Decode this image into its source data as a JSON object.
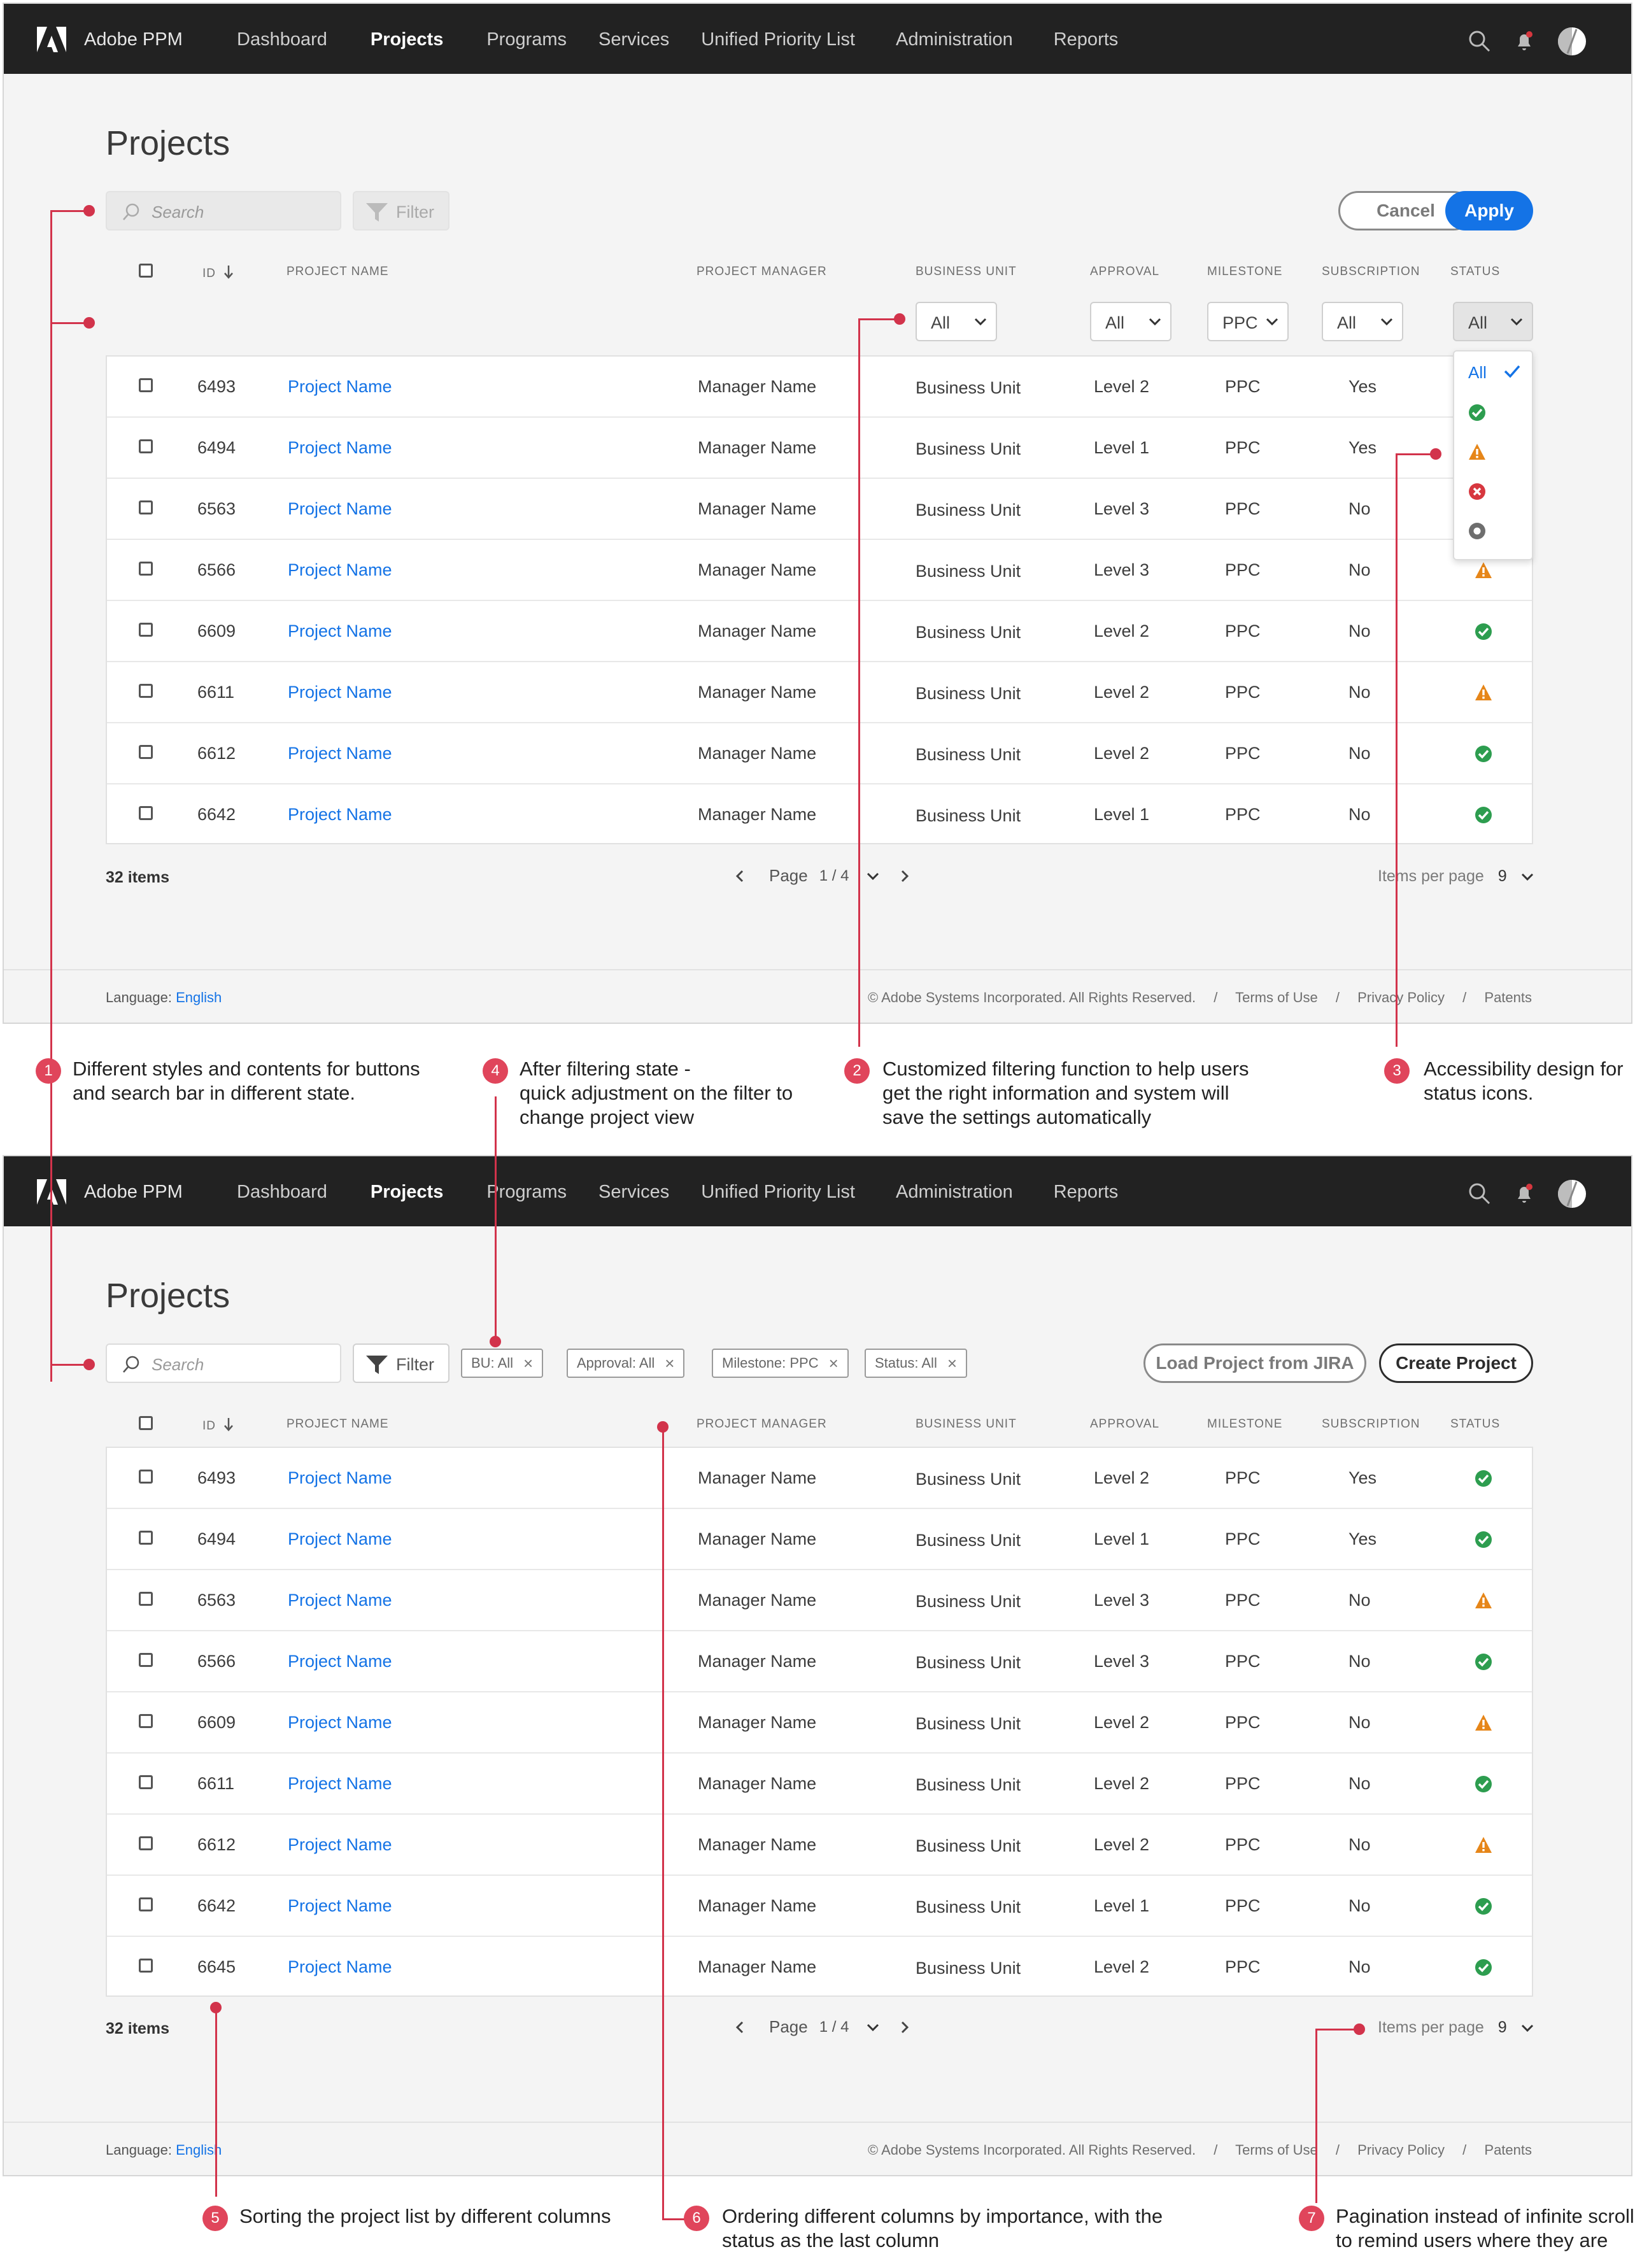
{
  "app": {
    "brand": "Adobe PPM"
  },
  "nav": {
    "items": [
      "Dashboard",
      "Projects",
      "Programs",
      "Services",
      "Unified Priority List",
      "Administration",
      "Reports"
    ],
    "active": "Projects"
  },
  "page": {
    "title": "Projects"
  },
  "search": {
    "placeholder": "Search"
  },
  "filter_label": "Filter",
  "buttons": {
    "cancel": "Cancel",
    "apply": "Apply",
    "load_jira": "Load Project from JIRA",
    "create_project": "Create Project"
  },
  "columns": {
    "id": "ID",
    "name": "PROJECT NAME",
    "manager": "PROJECT MANAGER",
    "bu": "BUSINESS UNIT",
    "approval": "APPROVAL",
    "milestone": "MILESTONE",
    "subscription": "SUBSCRIPTION",
    "status": "STATUS"
  },
  "column_filters": {
    "bu": "All",
    "approval": "All",
    "milestone": "PPC",
    "subscription": "All",
    "status": "All"
  },
  "status_menu": {
    "all_label": "All",
    "options": [
      "success",
      "warning",
      "error",
      "inactive"
    ]
  },
  "rows1": [
    {
      "id": "6493",
      "name": "Project Name",
      "manager": "Manager Name",
      "bu": "Business Unit",
      "approval": "Level 2",
      "milestone": "PPC",
      "subscription": "Yes",
      "status": null
    },
    {
      "id": "6494",
      "name": "Project Name",
      "manager": "Manager Name",
      "bu": "Business Unit",
      "approval": "Level 1",
      "milestone": "PPC",
      "subscription": "Yes",
      "status": null
    },
    {
      "id": "6563",
      "name": "Project Name",
      "manager": "Manager Name",
      "bu": "Business Unit",
      "approval": "Level 3",
      "milestone": "PPC",
      "subscription": "No",
      "status": null
    },
    {
      "id": "6566",
      "name": "Project Name",
      "manager": "Manager Name",
      "bu": "Business Unit",
      "approval": "Level 3",
      "milestone": "PPC",
      "subscription": "No",
      "status": "warning"
    },
    {
      "id": "6609",
      "name": "Project Name",
      "manager": "Manager Name",
      "bu": "Business Unit",
      "approval": "Level 2",
      "milestone": "PPC",
      "subscription": "No",
      "status": "success"
    },
    {
      "id": "6611",
      "name": "Project Name",
      "manager": "Manager Name",
      "bu": "Business Unit",
      "approval": "Level 2",
      "milestone": "PPC",
      "subscription": "No",
      "status": "warning"
    },
    {
      "id": "6612",
      "name": "Project Name",
      "manager": "Manager Name",
      "bu": "Business Unit",
      "approval": "Level 2",
      "milestone": "PPC",
      "subscription": "No",
      "status": "success"
    },
    {
      "id": "6642",
      "name": "Project Name",
      "manager": "Manager Name",
      "bu": "Business Unit",
      "approval": "Level 1",
      "milestone": "PPC",
      "subscription": "No",
      "status": "success"
    }
  ],
  "rows2": [
    {
      "id": "6493",
      "name": "Project Name",
      "manager": "Manager Name",
      "bu": "Business Unit",
      "approval": "Level 2",
      "milestone": "PPC",
      "subscription": "Yes",
      "status": "success"
    },
    {
      "id": "6494",
      "name": "Project Name",
      "manager": "Manager Name",
      "bu": "Business Unit",
      "approval": "Level 1",
      "milestone": "PPC",
      "subscription": "Yes",
      "status": "success"
    },
    {
      "id": "6563",
      "name": "Project Name",
      "manager": "Manager Name",
      "bu": "Business Unit",
      "approval": "Level 3",
      "milestone": "PPC",
      "subscription": "No",
      "status": "warning"
    },
    {
      "id": "6566",
      "name": "Project Name",
      "manager": "Manager Name",
      "bu": "Business Unit",
      "approval": "Level 3",
      "milestone": "PPC",
      "subscription": "No",
      "status": "success"
    },
    {
      "id": "6609",
      "name": "Project Name",
      "manager": "Manager Name",
      "bu": "Business Unit",
      "approval": "Level 2",
      "milestone": "PPC",
      "subscription": "No",
      "status": "warning"
    },
    {
      "id": "6611",
      "name": "Project Name",
      "manager": "Manager Name",
      "bu": "Business Unit",
      "approval": "Level 2",
      "milestone": "PPC",
      "subscription": "No",
      "status": "success"
    },
    {
      "id": "6612",
      "name": "Project Name",
      "manager": "Manager Name",
      "bu": "Business Unit",
      "approval": "Level 2",
      "milestone": "PPC",
      "subscription": "No",
      "status": "warning"
    },
    {
      "id": "6642",
      "name": "Project Name",
      "manager": "Manager Name",
      "bu": "Business Unit",
      "approval": "Level 1",
      "milestone": "PPC",
      "subscription": "No",
      "status": "success"
    },
    {
      "id": "6645",
      "name": "Project Name",
      "manager": "Manager Name",
      "bu": "Business Unit",
      "approval": "Level 2",
      "milestone": "PPC",
      "subscription": "No",
      "status": "success"
    }
  ],
  "pagination": {
    "items_label": "32 items",
    "page_label": "Page",
    "page_value": "1 / 4",
    "per_page_label": "Items per page",
    "per_page_value": "9"
  },
  "chips": [
    "BU: All",
    "Approval: All",
    "Milestone: PPC",
    "Status: All"
  ],
  "footer": {
    "language_label": "Language:",
    "language_value": "English",
    "copyright": "© Adobe Systems Incorporated. All Rights Reserved.",
    "terms": "Terms of Use",
    "privacy": "Privacy Policy",
    "patents": "Patents",
    "separator": "/"
  },
  "annotations": [
    {
      "num": "1",
      "text": "Different styles and contents for buttons\nand search bar in different state."
    },
    {
      "num": "4",
      "text": "After filtering state -\nquick adjustment on the filter to\nchange project view"
    },
    {
      "num": "2",
      "text": "Customized filtering function to help users\nget the right information and system will\nsave the settings automatically"
    },
    {
      "num": "3",
      "text": "Accessibility design for\nstatus icons."
    },
    {
      "num": "5",
      "text": "Sorting the project list by different columns"
    },
    {
      "num": "6",
      "text": "Ordering different columns by importance, with the\nstatus as the last column"
    },
    {
      "num": "7",
      "text": "Pagination instead of infinite scroll\nto remind users where they are"
    }
  ],
  "colors": {
    "nav_bg": "#222222",
    "link": "#1473e6",
    "success": "#2d9d4f",
    "warning": "#e68619",
    "error": "#d7373f",
    "inactive": "#6e6e6e",
    "annotation": "#d2334b"
  },
  "icons": [
    "adobe-logo-icon",
    "search-icon",
    "bell-icon",
    "avatar",
    "filter-icon",
    "chevron-down-icon",
    "chevron-left-icon",
    "chevron-right-icon",
    "sort-arrow-icon",
    "check-icon",
    "status-success-icon",
    "status-warning-icon",
    "status-error-icon",
    "status-inactive-icon"
  ]
}
